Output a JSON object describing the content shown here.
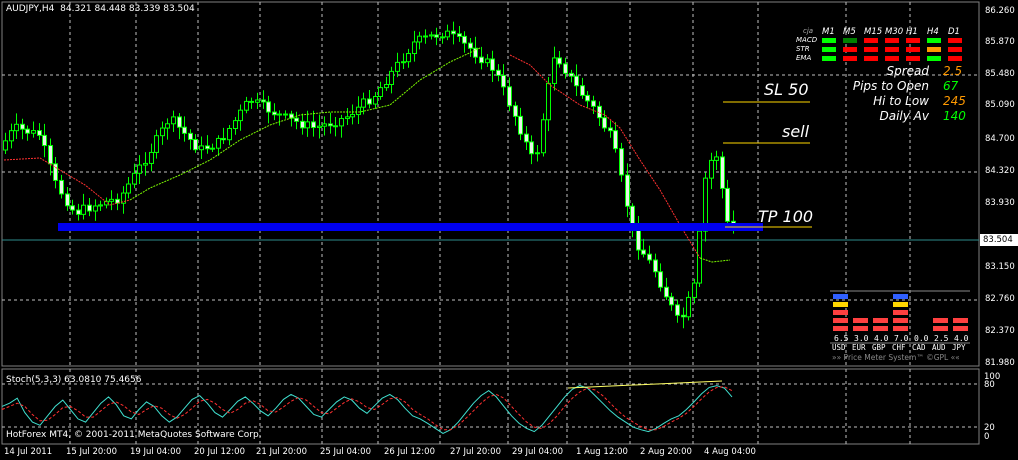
{
  "header": {
    "symbol": "AUDJPY,H4",
    "ohlc": "84.321 84.448 83.339 83.504"
  },
  "price_axis": [
    "86.260",
    "85.870",
    "85.480",
    "85.090",
    "84.700",
    "84.320",
    "83.930",
    "83.150",
    "82.760",
    "82.370",
    "81.980"
  ],
  "current_price": "83.504",
  "time_axis": [
    "14 Jul 2011",
    "15 Jul 20:00",
    "19 Jul 04:00",
    "20 Jul 12:00",
    "21 Jul 20:00",
    "25 Jul 04:00",
    "26 Jul 12:00",
    "27 Jul 20:00",
    "29 Jul 04:00",
    "1 Aug 12:00",
    "2 Aug 20:00",
    "4 Aug 04:00"
  ],
  "levels": {
    "sl": "SL 50",
    "sell": "sell",
    "tp": "TP 100"
  },
  "signal_panel": {
    "corner_label": "cja",
    "timeframes": [
      "M1",
      "M5",
      "M15",
      "M30",
      "H1",
      "H4",
      "D1"
    ],
    "rows": [
      {
        "label": "MACD",
        "colors": [
          "#00ff00",
          "#008000",
          "#ff0000",
          "#ff0000",
          "#ff0000",
          "#00ff00",
          "#ff0000"
        ]
      },
      {
        "label": "STR",
        "colors": [
          "#00ff00",
          "#ff0000",
          "#ff0000",
          "#ff0000",
          "#ff0000",
          "#ff9900",
          "#ff0000"
        ]
      },
      {
        "label": "EMA",
        "colors": [
          "#00ff00",
          "#ff0000",
          "#ff0000",
          "#ff0000",
          "#ff0000",
          "#00ff00",
          "#ff0000"
        ]
      }
    ],
    "stats": [
      {
        "label": "Spread",
        "value": "2.5",
        "color": "#ff9900"
      },
      {
        "label": "Pips to Open",
        "value": "67",
        "color": "#00ff00"
      },
      {
        "label": "Hi to Low",
        "value": "245",
        "color": "#ff9900"
      },
      {
        "label": "Daily Av",
        "value": "140",
        "color": "#00ff00"
      }
    ]
  },
  "price_meter": {
    "currencies": [
      "USD",
      "EUR",
      "GBP",
      "CHF",
      "CAD",
      "AUD",
      "JPY"
    ],
    "values": [
      "6.5",
      "3.0",
      "4.0",
      "7.0",
      "0.0",
      "2.5",
      "4.0"
    ],
    "footer": "»» Price Meter System™ ©GPL ««"
  },
  "stoch": {
    "title": "Stoch(5,3,3) 63.0810 75.4656",
    "levels": [
      "100",
      "80",
      "20",
      "0"
    ],
    "main_values": [
      55,
      60,
      68,
      45,
      30,
      25,
      40,
      55,
      65,
      50,
      35,
      30,
      45,
      60,
      70,
      58,
      40,
      35,
      50,
      62,
      55,
      40,
      30,
      38,
      52,
      66,
      72,
      60,
      45,
      38,
      50,
      63,
      70,
      60,
      48,
      40,
      52,
      66,
      74,
      68,
      55,
      42,
      38,
      50,
      62,
      70,
      65,
      52,
      44,
      56,
      68,
      74,
      66,
      52,
      40,
      35,
      28,
      20,
      12,
      18,
      30,
      45,
      60,
      72,
      80,
      70,
      55,
      40,
      28,
      20,
      15,
      25,
      40,
      55,
      70,
      82,
      88,
      84,
      72,
      60,
      48,
      38,
      30,
      22,
      18,
      15,
      20,
      28,
      35,
      40,
      50,
      62,
      75,
      85,
      88,
      84,
      70
    ],
    "signal_values": [
      50,
      55,
      60,
      55,
      42,
      32,
      33,
      42,
      53,
      55,
      48,
      38,
      38,
      48,
      58,
      62,
      56,
      46,
      42,
      50,
      56,
      52,
      42,
      36,
      42,
      52,
      63,
      66,
      60,
      50,
      44,
      50,
      60,
      64,
      58,
      48,
      46,
      54,
      63,
      69,
      65,
      55,
      45,
      43,
      52,
      61,
      67,
      62,
      53,
      50,
      58,
      67,
      69,
      62,
      50,
      42,
      35,
      26,
      18,
      18,
      25,
      36,
      48,
      60,
      70,
      74,
      68,
      55,
      42,
      30,
      22,
      20,
      28,
      40,
      55,
      68,
      78,
      84,
      81,
      72,
      60,
      48,
      38,
      30,
      23,
      18,
      18,
      23,
      30,
      36,
      44,
      55,
      67,
      78,
      85,
      86,
      80
    ]
  },
  "footer": "HotForex MT4, © 2001-2011 MetaQuotes Software Corp."
}
